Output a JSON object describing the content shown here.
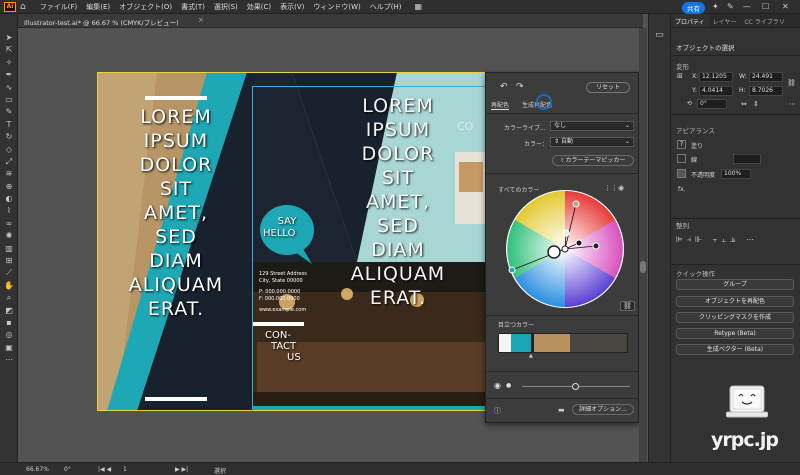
{
  "menubar": {
    "items": [
      "ファイル(F)",
      "編集(E)",
      "オブジェクト(O)",
      "書式(T)",
      "選択(S)",
      "効果(C)",
      "表示(V)",
      "ウィンドウ(W)",
      "ヘルプ(H)"
    ],
    "share": "共有"
  },
  "document": {
    "tab_title": "Illustrator-test.ai* @ 66.67 % (CMYK/プレビュー)"
  },
  "artboard": {
    "left_text": [
      "LOREM",
      "IPSUM",
      "DOLOR",
      "SIT",
      "AMET,",
      "SED",
      "DIAM",
      "ALIQUAM",
      "ERAT."
    ],
    "right_text": [
      "LOREM",
      "IPSUM",
      "DOLOR",
      "SIT",
      "AMET,",
      "SED",
      "DIAM",
      "ALIQUAM",
      "ERAT."
    ],
    "say": "SAY",
    "hello": "HELLO",
    "address": [
      "129 Street Address",
      "City, State 00000",
      "P: 000.000.0000",
      "F: 000.000.0000",
      "www.example.com"
    ],
    "contact": [
      "CON-",
      "TACT",
      "US"
    ],
    "corner": "CO"
  },
  "dialog": {
    "reset": "リセット",
    "tab_recolor": "再配色",
    "tab_gen": "生成再配色",
    "library_label": "カラーライブ...",
    "library_value": "なし",
    "colors_label": "カラー：",
    "colors_value": "自動",
    "theme_picker": "カラーテーマピッカー",
    "all_colors": "すべてのカラー",
    "prominent": "目立つカラー",
    "advanced": "詳細オプション...",
    "swatches": [
      "#f4f4f4",
      "#1aa6b5",
      "#16222c",
      "#b9915e",
      "#4a4640"
    ]
  },
  "rpanel": {
    "tabs": [
      "プロパティ",
      "レイヤー",
      "CC ライブラリ"
    ],
    "selected": "オブジェクトの選択",
    "transform": "変形",
    "x": "12.1205",
    "w": "24.491",
    "y": "4.0414",
    "h": "8.7026",
    "angle": "0°",
    "appearance": "アピアランス",
    "fill": "塗り",
    "stroke": "線",
    "opacity_label": "不透明度",
    "opacity": "100%",
    "fx": "fx.",
    "align": "整列",
    "quick": "クイック操作",
    "buttons": [
      "グループ",
      "オブジェクトを再配色",
      "クリッピングマスクを作成",
      "Retype (Beta)",
      "生成ベクター (Beta)"
    ]
  },
  "status": {
    "zoom": "66.67%",
    "angle": "0°",
    "page": "1",
    "tool": "選択"
  },
  "watermark": "yrpc.jp"
}
